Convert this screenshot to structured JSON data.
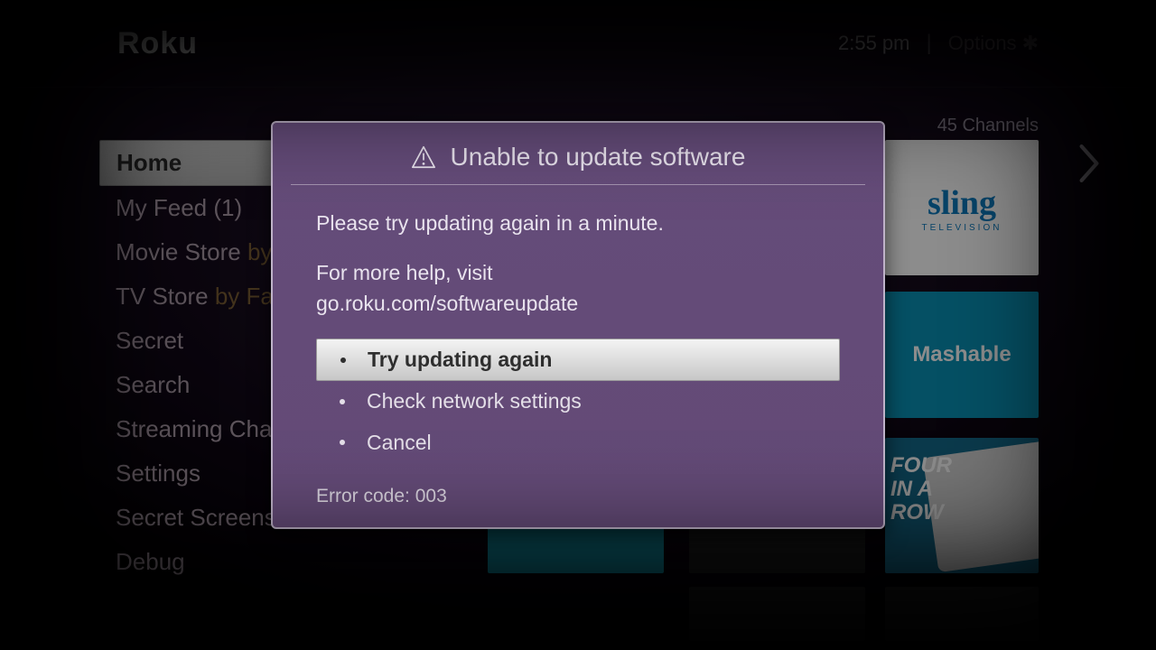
{
  "header": {
    "brand": "Roku",
    "time": "2:55  pm",
    "options_label": "Options"
  },
  "channels_count": "45 Channels",
  "sidebar": {
    "items": [
      {
        "label": "Home",
        "suffix": ""
      },
      {
        "label": "My Feed (1)",
        "suffix": ""
      },
      {
        "label": "Movie Store ",
        "suffix": "by"
      },
      {
        "label": "TV Store ",
        "suffix": "by Fa"
      },
      {
        "label": "Secret",
        "suffix": ""
      },
      {
        "label": "Search",
        "suffix": ""
      },
      {
        "label": "Streaming Cha",
        "suffix": ""
      },
      {
        "label": "Settings",
        "suffix": ""
      },
      {
        "label": "Secret Screens",
        "suffix": ""
      },
      {
        "label": "Debug",
        "suffix": ""
      }
    ]
  },
  "tiles": {
    "sling_name": "sling",
    "sling_sub": "TELEVISION",
    "mashable": "Mashable",
    "four_line1": "FOUR",
    "four_line2": "IN A",
    "four_line3": "ROW"
  },
  "modal": {
    "title": "Unable to update software",
    "body_line1": "Please try updating again in a minute.",
    "body_line2": "For more help, visit",
    "body_line3": "go.roku.com/softwareupdate",
    "options": [
      "Try updating again",
      "Check network settings",
      "Cancel"
    ],
    "error": "Error code: 003"
  }
}
